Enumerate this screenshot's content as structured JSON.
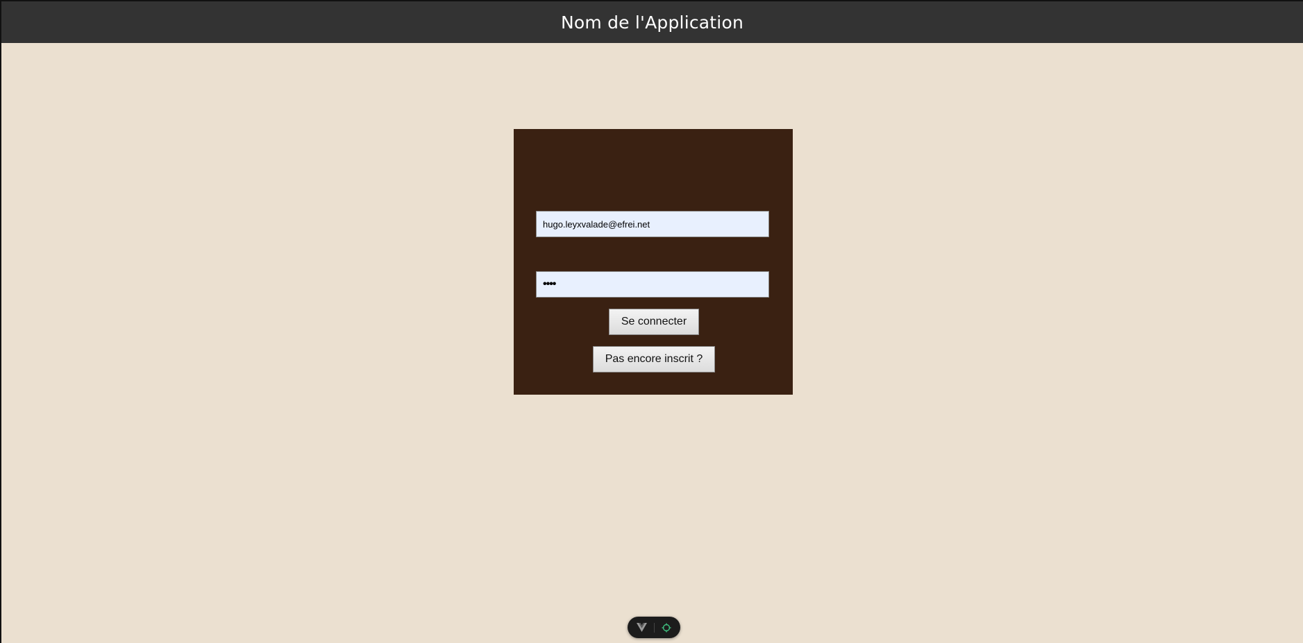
{
  "header": {
    "title": "Nom de l'Application"
  },
  "login": {
    "email_value": "hugo.leyxvalade@efrei.net",
    "password_value": "••••",
    "login_button": "Se connecter",
    "register_button": "Pas encore inscrit ?"
  },
  "devtools": {
    "icons": [
      "vue-logo-icon",
      "target-icon"
    ]
  },
  "colors": {
    "header_bg": "#333333",
    "page_bg": "#ebe0d0",
    "card_bg": "#3a2112",
    "input_bg": "#e8f0fe"
  }
}
